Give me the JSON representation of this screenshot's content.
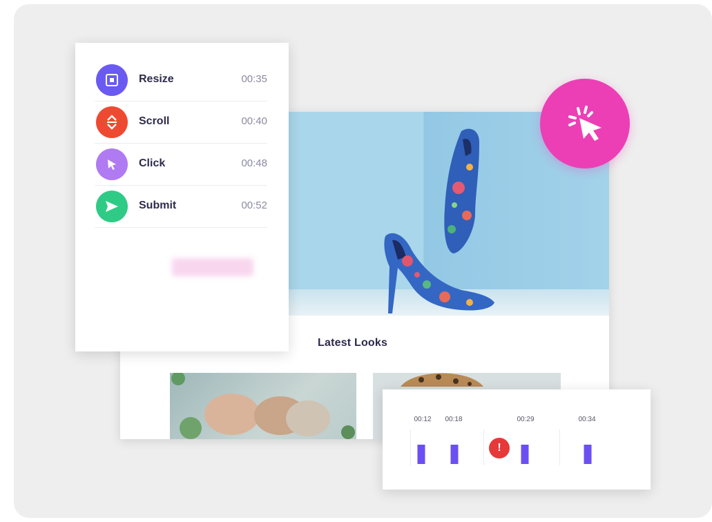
{
  "events": [
    {
      "label": "Resize",
      "time": "00:35",
      "icon": "resize-icon",
      "color": "#6a5af2"
    },
    {
      "label": "Scroll",
      "time": "00:40",
      "icon": "scroll-icon",
      "color": "#ee4a32"
    },
    {
      "label": "Click",
      "time": "00:48",
      "icon": "pointer-icon",
      "color": "#b07af2"
    },
    {
      "label": "Submit",
      "time": "00:52",
      "icon": "send-icon",
      "color": "#2fcb86"
    }
  ],
  "site": {
    "title": "Latest Looks"
  },
  "timeline": {
    "times": [
      "00:12",
      "00:18",
      "00:29",
      "00:34"
    ],
    "error_symbol": "!"
  },
  "colors": {
    "accent_pink": "#ec3fb6",
    "bar_purple": "#6b4ff2",
    "error_red": "#e5393a"
  }
}
